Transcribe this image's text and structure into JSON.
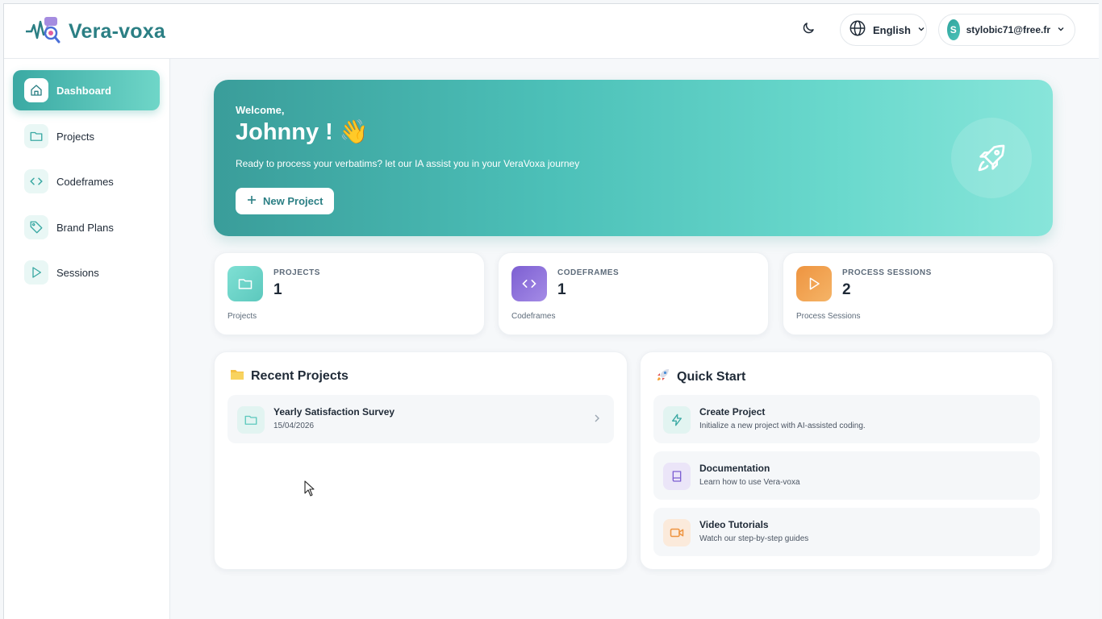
{
  "app": {
    "title": "Vera-voxa"
  },
  "header": {
    "language": "English",
    "user_initial": "S",
    "user_email": "stylobic71@free.fr"
  },
  "sidebar": {
    "items": [
      {
        "label": "Dashboard",
        "icon": "home-icon",
        "active": true
      },
      {
        "label": "Projects",
        "icon": "folder-icon"
      },
      {
        "label": "Codeframes",
        "icon": "code-icon"
      },
      {
        "label": "Brand Plans",
        "icon": "tag-icon"
      },
      {
        "label": "Sessions",
        "icon": "play-icon"
      }
    ]
  },
  "hero": {
    "welcome": "Welcome,",
    "name": "Johnny ! 👋",
    "subtitle": "Ready to process your verbatims? let our IA assist you in your VeraVoxa journey",
    "button": "New Project"
  },
  "stats": [
    {
      "label": "PROJECTS",
      "value": "1",
      "foot": "Projects",
      "color": "#5fd0c4"
    },
    {
      "label": "CODEFRAMES",
      "value": "1",
      "foot": "Codeframes",
      "color": "#8b6fd8"
    },
    {
      "label": "PROCESS SESSIONS",
      "value": "2",
      "foot": "Process Sessions",
      "color": "#f0a04f"
    }
  ],
  "recent_projects": {
    "title": "Recent Projects",
    "items": [
      {
        "name": "Yearly Satisfaction Survey",
        "date": "15/04/2026"
      }
    ]
  },
  "quick_start": {
    "title": "Quick Start",
    "items": [
      {
        "title": "Create Project",
        "sub": "Initialize a new project with AI-assisted coding.",
        "icon": "bolt-icon"
      },
      {
        "title": "Documentation",
        "sub": "Learn how to use Vera-voxa",
        "icon": "book-icon"
      },
      {
        "title": "Video Tutorials",
        "sub": "Watch our step-by-step guides",
        "icon": "video-icon"
      }
    ]
  },
  "colors": {
    "accent": "#2b7f84",
    "teal_light": "#6fd6c8"
  }
}
